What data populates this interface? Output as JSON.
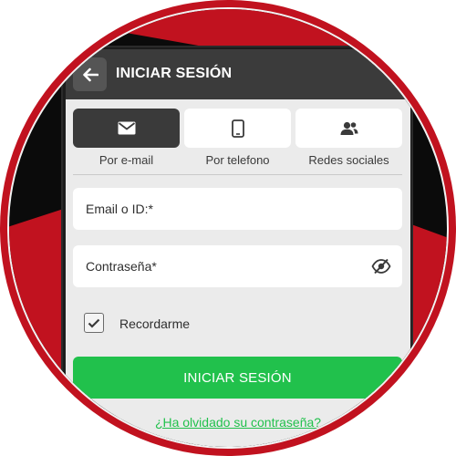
{
  "header": {
    "title": "INICIAR SESIÓN",
    "back_icon": "arrow-left-icon"
  },
  "tabs": [
    {
      "label": "Por e-mail",
      "icon": "envelope-icon",
      "active": true
    },
    {
      "label": "Por telefono",
      "icon": "smartphone-icon",
      "active": false
    },
    {
      "label": "Redes sociales",
      "icon": "users-icon",
      "active": false
    }
  ],
  "form": {
    "email_placeholder": "Email o ID:*",
    "email_value": "",
    "password_placeholder": "Contraseña*",
    "password_value": "",
    "password_toggle_icon": "eye-slash-icon",
    "remember_label": "Recordarme",
    "remember_checked": true,
    "submit_label": "INICIAR SESIÓN",
    "forgot_link": "¿Ha olvidado su contraseña?"
  },
  "colors": {
    "brand_red": "#c1121f",
    "header_bg": "#3b3b3b",
    "accent_green": "#21c14c",
    "screen_bg": "#ebebeb"
  }
}
